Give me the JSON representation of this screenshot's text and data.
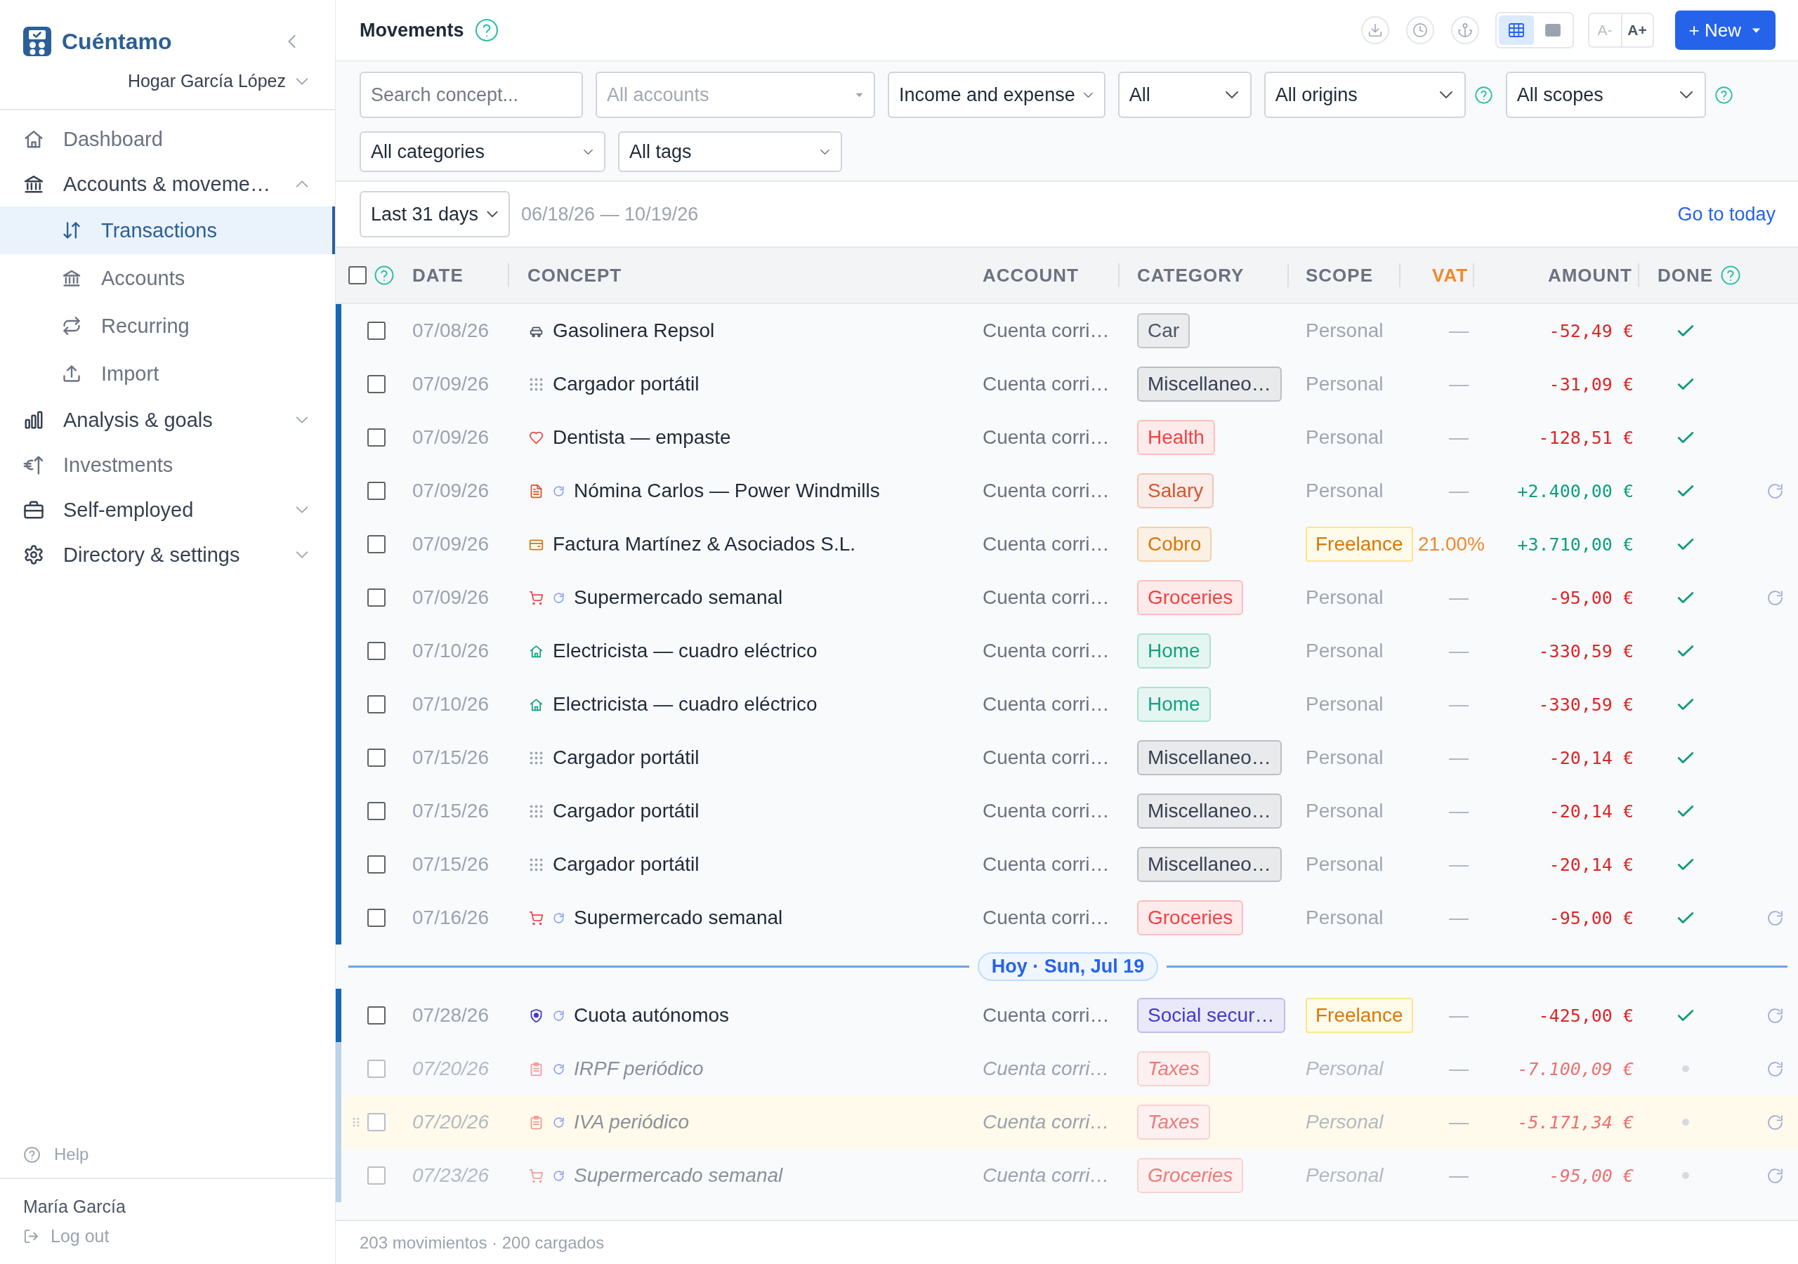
{
  "sidebar": {
    "brand": "Cuéntamo",
    "household": "Hogar García López",
    "nav": [
      {
        "label": "Dashboard",
        "selected": false
      },
      {
        "label": "Accounts & moveme…",
        "selected": false,
        "expanded": true,
        "children": [
          {
            "label": "Transactions",
            "selected": true
          },
          {
            "label": "Accounts",
            "selected": false
          },
          {
            "label": "Recurring",
            "selected": false
          },
          {
            "label": "Import",
            "selected": false
          }
        ]
      },
      {
        "label": "Analysis & goals",
        "selected": false,
        "expanded": false
      },
      {
        "label": "Investments",
        "selected": false
      },
      {
        "label": "Self-employed",
        "selected": false,
        "expanded": false
      },
      {
        "label": "Directory & settings",
        "selected": false,
        "expanded": false
      }
    ],
    "help": "Help",
    "user": "María García",
    "logout": "Log out"
  },
  "header": {
    "title": "Movements",
    "view_options": [
      {
        "selected": true
      },
      {
        "selected": false
      }
    ],
    "font_size_buttons": [
      {
        "label": "A-",
        "disabled": true
      },
      {
        "label": "A+",
        "disabled": false
      }
    ],
    "new_button": "+ New"
  },
  "filters": {
    "search": {
      "placeholder": "Search concept..."
    },
    "selects": [
      {
        "value": "All accounts",
        "kind": "native",
        "disabled": true,
        "help": false
      },
      {
        "value": "Income and expense",
        "kind": "compact",
        "disabled": false,
        "help": false
      },
      {
        "value": "All",
        "kind": "menu",
        "disabled": false,
        "help": false
      },
      {
        "value": "All origins",
        "kind": "menu",
        "disabled": false,
        "help": true
      },
      {
        "value": "All scopes",
        "kind": "menu",
        "disabled": false,
        "help": true
      }
    ],
    "more_selects": [
      {
        "value": "All categories",
        "kind": "compact",
        "disabled": false,
        "help": false
      },
      {
        "value": "All tags",
        "kind": "compact",
        "disabled": false,
        "help": false
      }
    ]
  },
  "period": {
    "range": "Last 31 days",
    "dates": "06/18/26 — 10/19/26",
    "today_link": "Go to today"
  },
  "table": {
    "select_all": {
      "checked": false
    },
    "columns": [
      {
        "label": "DATE",
        "highlighted": false,
        "help": false
      },
      {
        "label": "CONCEPT",
        "highlighted": false,
        "help": false
      },
      {
        "label": "ACCOUNT",
        "highlighted": false,
        "help": false
      },
      {
        "label": "CATEGORY",
        "highlighted": false,
        "help": false
      },
      {
        "label": "SCOPE",
        "highlighted": false,
        "help": false
      },
      {
        "label": "VAT",
        "highlighted": true,
        "help": false
      },
      {
        "label": "AMOUNT",
        "highlighted": false,
        "help": false
      },
      {
        "label": "DONE",
        "highlighted": false,
        "help": true
      }
    ],
    "rows": [
      {
        "kind": "transaction",
        "checked": false,
        "date": "07/08/26",
        "concept": "Gasolinera Repsol",
        "recurring": false,
        "account": "Cuenta corri…",
        "category": {
          "label": "Car",
          "kind": "car",
          "color": "#4b5563"
        },
        "scope": {
          "label": "Personal",
          "kind": "plain"
        },
        "vat": {
          "text": "—",
          "kind": "none"
        },
        "amount": {
          "text": "-52,49 €",
          "kind": "expense"
        },
        "done": true,
        "projected": false,
        "hovered": false
      },
      {
        "kind": "transaction",
        "checked": false,
        "date": "07/09/26",
        "concept": "Cargador portátil",
        "recurring": false,
        "account": "Cuenta corri…",
        "category": {
          "label": "Miscellaneo…",
          "kind": "misc",
          "color": "#374151"
        },
        "scope": {
          "label": "Personal",
          "kind": "plain"
        },
        "vat": {
          "text": "—",
          "kind": "none"
        },
        "amount": {
          "text": "-31,09 €",
          "kind": "expense"
        },
        "done": true,
        "projected": false,
        "hovered": false
      },
      {
        "kind": "transaction",
        "checked": false,
        "date": "07/09/26",
        "concept": "Dentista — empaste",
        "recurring": false,
        "account": "Cuenta corri…",
        "category": {
          "label": "Health",
          "kind": "health",
          "color": "#ef4444"
        },
        "scope": {
          "label": "Personal",
          "kind": "plain"
        },
        "vat": {
          "text": "—",
          "kind": "none"
        },
        "amount": {
          "text": "-128,51 €",
          "kind": "expense"
        },
        "done": true,
        "projected": false,
        "hovered": false
      },
      {
        "kind": "transaction",
        "checked": false,
        "date": "07/09/26",
        "concept": "Nómina Carlos — Power Windmills",
        "recurring": true,
        "account": "Cuenta corri…",
        "category": {
          "label": "Salary",
          "kind": "salary",
          "color": "#d4552b"
        },
        "scope": {
          "label": "Personal",
          "kind": "plain"
        },
        "vat": {
          "text": "—",
          "kind": "none"
        },
        "amount": {
          "text": "+2.400,00 €",
          "kind": "income"
        },
        "done": true,
        "projected": false,
        "hovered": false
      },
      {
        "kind": "transaction",
        "checked": false,
        "date": "07/09/26",
        "concept": "Factura Martínez & Asociados S.L.",
        "recurring": false,
        "account": "Cuenta corri…",
        "category": {
          "label": "Cobro",
          "kind": "invoice",
          "color": "#d97706"
        },
        "scope": {
          "label": "Freelance",
          "kind": "tag"
        },
        "vat": {
          "text": "21.00%",
          "kind": "rate"
        },
        "amount": {
          "text": "+3.710,00 €",
          "kind": "income"
        },
        "done": true,
        "projected": false,
        "hovered": false
      },
      {
        "kind": "transaction",
        "checked": false,
        "date": "07/09/26",
        "concept": "Supermercado semanal",
        "recurring": true,
        "account": "Cuenta corri…",
        "category": {
          "label": "Groceries",
          "kind": "groceries",
          "color": "#ef4444"
        },
        "scope": {
          "label": "Personal",
          "kind": "plain"
        },
        "vat": {
          "text": "—",
          "kind": "none"
        },
        "amount": {
          "text": "-95,00 €",
          "kind": "expense"
        },
        "done": true,
        "projected": false,
        "hovered": false
      },
      {
        "kind": "transaction",
        "checked": false,
        "date": "07/10/26",
        "concept": "Electricista — cuadro eléctrico",
        "recurring": false,
        "account": "Cuenta corri…",
        "category": {
          "label": "Home",
          "kind": "home",
          "color": "#14a37f"
        },
        "scope": {
          "label": "Personal",
          "kind": "plain"
        },
        "vat": {
          "text": "—",
          "kind": "none"
        },
        "amount": {
          "text": "-330,59 €",
          "kind": "expense"
        },
        "done": true,
        "projected": false,
        "hovered": false
      },
      {
        "kind": "transaction",
        "checked": false,
        "date": "07/10/26",
        "concept": "Electricista — cuadro eléctrico",
        "recurring": false,
        "account": "Cuenta corri…",
        "category": {
          "label": "Home",
          "kind": "home",
          "color": "#14a37f"
        },
        "scope": {
          "label": "Personal",
          "kind": "plain"
        },
        "vat": {
          "text": "—",
          "kind": "none"
        },
        "amount": {
          "text": "-330,59 €",
          "kind": "expense"
        },
        "done": true,
        "projected": false,
        "hovered": false
      },
      {
        "kind": "transaction",
        "checked": false,
        "date": "07/15/26",
        "concept": "Cargador portátil",
        "recurring": false,
        "account": "Cuenta corri…",
        "category": {
          "label": "Miscellaneo…",
          "kind": "misc",
          "color": "#374151"
        },
        "scope": {
          "label": "Personal",
          "kind": "plain"
        },
        "vat": {
          "text": "—",
          "kind": "none"
        },
        "amount": {
          "text": "-20,14 €",
          "kind": "expense"
        },
        "done": true,
        "projected": false,
        "hovered": false
      },
      {
        "kind": "transaction",
        "checked": false,
        "date": "07/15/26",
        "concept": "Cargador portátil",
        "recurring": false,
        "account": "Cuenta corri…",
        "category": {
          "label": "Miscellaneo…",
          "kind": "misc",
          "color": "#374151"
        },
        "scope": {
          "label": "Personal",
          "kind": "plain"
        },
        "vat": {
          "text": "—",
          "kind": "none"
        },
        "amount": {
          "text": "-20,14 €",
          "kind": "expense"
        },
        "done": true,
        "projected": false,
        "hovered": false
      },
      {
        "kind": "transaction",
        "checked": false,
        "date": "07/15/26",
        "concept": "Cargador portátil",
        "recurring": false,
        "account": "Cuenta corri…",
        "category": {
          "label": "Miscellaneo…",
          "kind": "misc",
          "color": "#374151"
        },
        "scope": {
          "label": "Personal",
          "kind": "plain"
        },
        "vat": {
          "text": "—",
          "kind": "none"
        },
        "amount": {
          "text": "-20,14 €",
          "kind": "expense"
        },
        "done": true,
        "projected": false,
        "hovered": false
      },
      {
        "kind": "transaction",
        "checked": false,
        "date": "07/16/26",
        "concept": "Supermercado semanal",
        "recurring": true,
        "account": "Cuenta corri…",
        "category": {
          "label": "Groceries",
          "kind": "groceries",
          "color": "#ef4444"
        },
        "scope": {
          "label": "Personal",
          "kind": "plain"
        },
        "vat": {
          "text": "—",
          "kind": "none"
        },
        "amount": {
          "text": "-95,00 €",
          "kind": "expense"
        },
        "done": true,
        "projected": false,
        "hovered": false
      },
      {
        "kind": "today",
        "label": "Hoy · Sun, Jul 19"
      },
      {
        "kind": "transaction",
        "checked": false,
        "date": "07/28/26",
        "concept": "Cuota autónomos",
        "recurring": true,
        "account": "Cuenta corri…",
        "category": {
          "label": "Social secur…",
          "kind": "social",
          "color": "#4338ca"
        },
        "scope": {
          "label": "Freelance",
          "kind": "tag"
        },
        "vat": {
          "text": "—",
          "kind": "none"
        },
        "amount": {
          "text": "-425,00 €",
          "kind": "expense"
        },
        "done": true,
        "projected": false,
        "hovered": false
      },
      {
        "kind": "transaction",
        "checked": false,
        "date": "07/20/26",
        "concept": "IRPF periódico",
        "recurring": true,
        "account": "Cuenta corri…",
        "category": {
          "label": "Taxes",
          "kind": "taxes",
          "color": "#ee7a7a"
        },
        "scope": {
          "label": "Personal",
          "kind": "plain"
        },
        "vat": {
          "text": "—",
          "kind": "none"
        },
        "amount": {
          "text": "-7.100,09 €",
          "kind": "expense"
        },
        "done": false,
        "projected": true,
        "hovered": false
      },
      {
        "kind": "transaction",
        "checked": false,
        "date": "07/20/26",
        "concept": "IVA periódico",
        "recurring": true,
        "account": "Cuenta corri…",
        "category": {
          "label": "Taxes",
          "kind": "taxes",
          "color": "#ee7a7a"
        },
        "scope": {
          "label": "Personal",
          "kind": "plain"
        },
        "vat": {
          "text": "—",
          "kind": "none"
        },
        "amount": {
          "text": "-5.171,34 €",
          "kind": "expense"
        },
        "done": false,
        "projected": true,
        "hovered": true
      },
      {
        "kind": "transaction",
        "checked": false,
        "date": "07/23/26",
        "concept": "Supermercado semanal",
        "recurring": true,
        "account": "Cuenta corri…",
        "category": {
          "label": "Groceries",
          "kind": "groceries",
          "color": "#ee7a7a"
        },
        "scope": {
          "label": "Personal",
          "kind": "plain"
        },
        "vat": {
          "text": "—",
          "kind": "none"
        },
        "amount": {
          "text": "-95,00 €",
          "kind": "expense"
        },
        "done": false,
        "projected": true,
        "hovered": false
      }
    ]
  },
  "footer": "203 movimientos · 200 cargados"
}
